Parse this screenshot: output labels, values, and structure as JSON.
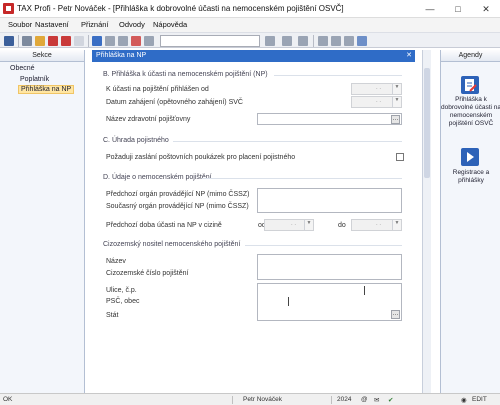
{
  "window": {
    "title": "TAX Profi - Petr Nováček - [Přihláška k dobrovolné účasti na nemocenském pojištění OSVČ]"
  },
  "menu": [
    "Soubor",
    "Nastavení",
    "Přiznání",
    "Odvody",
    "Nápověda"
  ],
  "left_panel": {
    "header": "Sekce",
    "tree": {
      "root": "Obecné",
      "items": [
        "Poplatník",
        "Přihláška na NP"
      ],
      "selected": "Přihláška na NP"
    }
  },
  "main": {
    "header": "Přihláška na NP",
    "section_b": {
      "title": "B. Přihláška k účasti na nemocenském pojištění (NP)",
      "label_insurance": "K účasti na pojištění přihlášen od",
      "label_start": "Datum zahájení (opětovného zahájení) SVČ",
      "label_health": "Název zdravotní pojišťovny",
      "date_placeholder": ". ."
    },
    "section_c": {
      "title": "C. Úhrada pojistného",
      "label_postal": "Požaduji zaslání poštovních poukázek pro placení pojistného",
      "postal_checked": false
    },
    "section_d": {
      "title": "D. Údaje o nemocenském pojištění",
      "label_prev_org": "Předchozí orgán provádějící NP (mimo ČSSZ)",
      "label_curr_org": "Současný orgán provádějící NP (mimo ČSSZ)",
      "label_prev_period": "Předchozí doba účasti na NP v cizině",
      "from_label": "od",
      "to_label": "do",
      "date_placeholder": ". ."
    },
    "section_foreign": {
      "title": "Cizozemský nositel nemocenského pojištění",
      "label_name": "Název",
      "label_number": "Cizozemské číslo pojištění",
      "label_street": "Ulice, č.p.",
      "label_zip": "PSČ, obec",
      "label_state": "Stát"
    }
  },
  "agenda": {
    "header": "Agendy",
    "items": [
      {
        "label": "Přihláška k dobrovolné účasti na nemocenském pojištění OSVČ",
        "icon": "document-pen-icon"
      },
      {
        "label": "Registrace a přihlášky",
        "icon": "arrow-right-icon"
      }
    ]
  },
  "status": {
    "left": "OK",
    "user": "Petr Nováček",
    "year": "2024",
    "mode": "EDIT"
  },
  "colors": {
    "header_blue": "#2f6cc7",
    "selected_item": "#ffe6a3",
    "panel_bg": "#f3f6fb"
  }
}
